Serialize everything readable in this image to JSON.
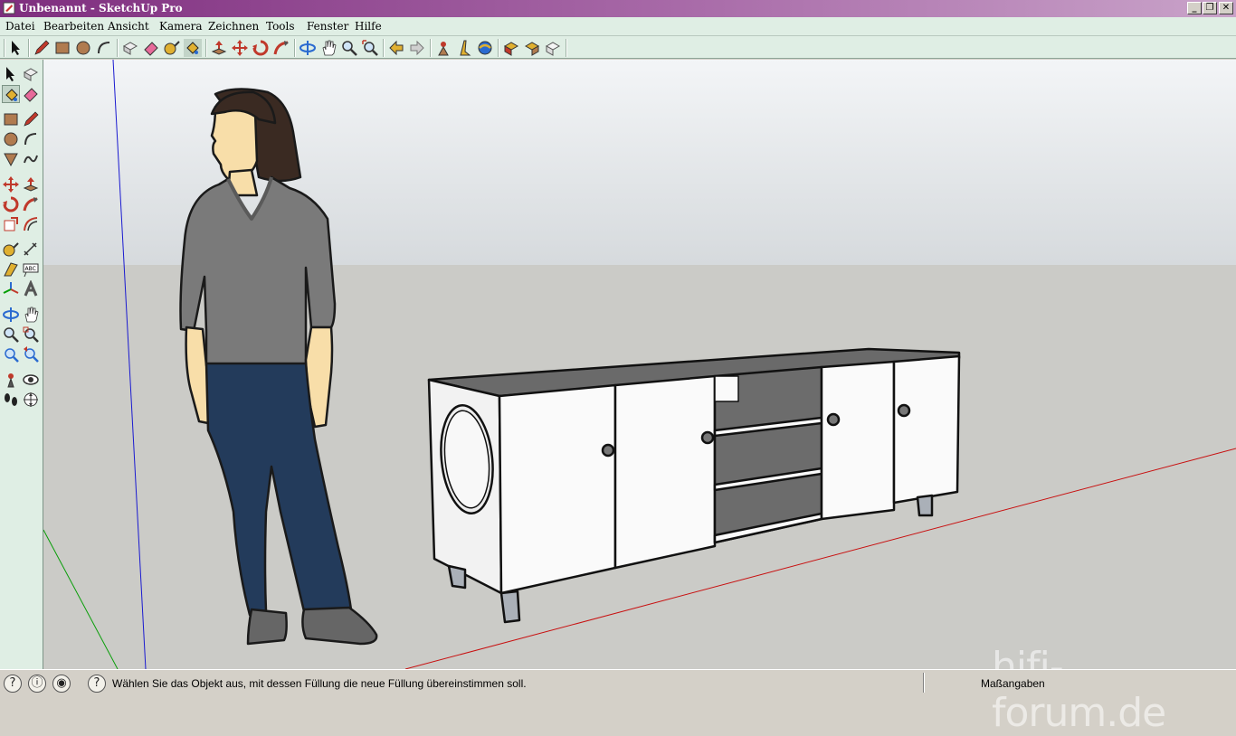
{
  "window": {
    "title": "Unbenannt - SketchUp Pro"
  },
  "menu": {
    "items": [
      "Datei",
      "Bearbeiten",
      "Ansicht",
      "Kamera",
      "Zeichnen",
      "Tools",
      "Fenster",
      "Hilfe"
    ]
  },
  "toolbar_top": {
    "tools": [
      "select-icon",
      "pencil-icon",
      "rectangle-icon",
      "circle-icon",
      "arc-icon",
      "make-component-icon",
      "eraser-icon",
      "tape-measure-icon",
      "paint-bucket-icon",
      "push-pull-icon",
      "move-icon",
      "rotate-icon",
      "follow-me-icon",
      "orbit-icon",
      "pan-icon",
      "zoom-icon",
      "zoom-extents-icon",
      "previous-view-icon",
      "next-view-icon",
      "position-camera-icon",
      "walk-icon",
      "look-around-icon",
      "get-models-icon",
      "share-model-icon",
      "share-component-icon"
    ]
  },
  "toolbar_left": {
    "tools": [
      "select-icon",
      "make-component-icon",
      "paint-bucket-icon",
      "eraser-icon",
      "rectangle-icon",
      "line-icon",
      "circle-icon",
      "arc-icon",
      "polygon-icon",
      "freehand-icon",
      "move-icon",
      "push-pull-icon",
      "rotate-icon",
      "follow-me-icon",
      "scale-icon",
      "offset-icon",
      "tape-measure-icon",
      "dimension-icon",
      "protractor-icon",
      "text-icon",
      "axes-icon",
      "3d-text-icon",
      "orbit-icon",
      "pan-icon",
      "zoom-icon",
      "zoom-window-icon",
      "zoom-extents-icon",
      "previous-icon",
      "position-camera-icon",
      "look-around-icon",
      "walk-icon",
      "section-plane-icon"
    ]
  },
  "status": {
    "message": "Wählen Sie das Objekt aus, mit dessen Füllung die neue Füllung übereinstimmen soll.",
    "measurements_label": "Maßangaben",
    "icons": [
      "geo-location-icon",
      "credits-icon",
      "account-icon",
      "help-icon"
    ]
  },
  "watermark": "hifi-forum.de",
  "colors": {
    "sky": "#dfe3e6",
    "ground": "#cbcbc7",
    "axis_red": "#c80000",
    "axis_green": "#009e00",
    "axis_blue": "#0000c8",
    "titlebar": "#7e2d7e",
    "toolbar": "#dfeee4"
  }
}
